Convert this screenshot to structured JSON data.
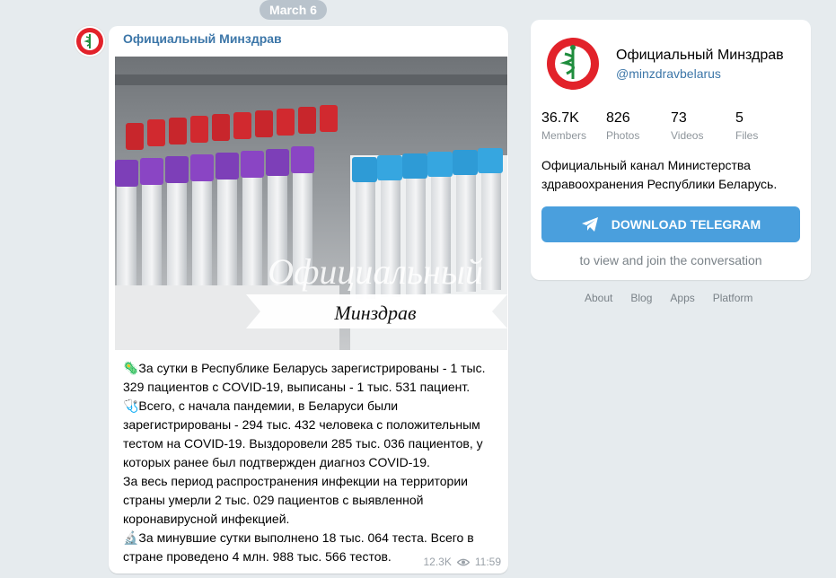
{
  "date_pill": "March 6",
  "message": {
    "channel_name": "Официальный Минздрав",
    "photo_overlay": {
      "line1": "Официальный",
      "line2": "Минздрав"
    },
    "paragraphs": [
      "🦠За сутки в Республике Беларусь зарегистрированы - 1 тыс. 329 пациентов с COVID-19, выписаны - 1 тыс. 531 пациент.",
      "🩺Всего, с начала пандемии, в Беларуси были зарегистрированы - 294 тыс. 432 человека с положительным тестом на COVID-19. Выздоровели 285 тыс. 036 пациентов, у которых ранее был подтвержден диагноз COVID-19.",
      "За весь период распространения инфекции на территории страны умерли 2 тыс. 029 пациентов с выявленной коронавирусной инфекцией.",
      "🔬За минувшие сутки выполнено 18 тыс. 064 теста. Всего в стране проведено 4 млн. 988 тыс. 566 тестов."
    ],
    "views": "12.3K",
    "time": "11:59"
  },
  "channel_card": {
    "title": "Официальный Минздрав",
    "handle": "@minzdravbelarus",
    "stats": [
      {
        "value": "36.7K",
        "label": "Members"
      },
      {
        "value": "826",
        "label": "Photos"
      },
      {
        "value": "73",
        "label": "Videos"
      },
      {
        "value": "5",
        "label": "Files"
      }
    ],
    "description": "Официальный канал Министерства здравоохранения Республики Беларусь.",
    "download_label": "DOWNLOAD TELEGRAM",
    "hint": "to view and join the conversation"
  },
  "footer_links": [
    "About",
    "Blog",
    "Apps",
    "Platform"
  ],
  "colors": {
    "background": "#e6ebee",
    "accent": "#3c76a8",
    "button": "#4a9fdd",
    "date_pill": "#b9c3cc"
  },
  "icons": {
    "channel_logo": "ministry-emblem-icon",
    "views": "eye-icon",
    "telegram": "telegram-plane-icon"
  }
}
